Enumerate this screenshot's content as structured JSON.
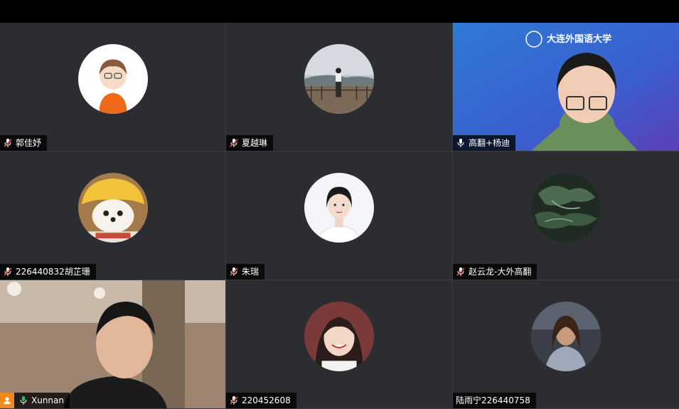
{
  "participants": [
    {
      "name": "郭佳妤",
      "mic": "muted"
    },
    {
      "name": "夏越琳",
      "mic": "muted"
    },
    {
      "name": "高翻+杨迪",
      "mic": "on"
    },
    {
      "name": "226440832胡芷珊",
      "mic": "muted"
    },
    {
      "name": "朱瑞",
      "mic": "muted"
    },
    {
      "name": "赵云龙-大外高翻",
      "mic": "muted"
    },
    {
      "name": "Xunnan",
      "mic": "on"
    },
    {
      "name": "220452608",
      "mic": "muted"
    },
    {
      "name": "陆雨宁226440758",
      "mic": "none"
    }
  ],
  "banner": {
    "university": "大连外国语大学"
  },
  "colors": {
    "muted": "#e8504a",
    "on": "#ffffff",
    "active_border": "#1fc46b",
    "host_badge": "#f08a1c"
  }
}
